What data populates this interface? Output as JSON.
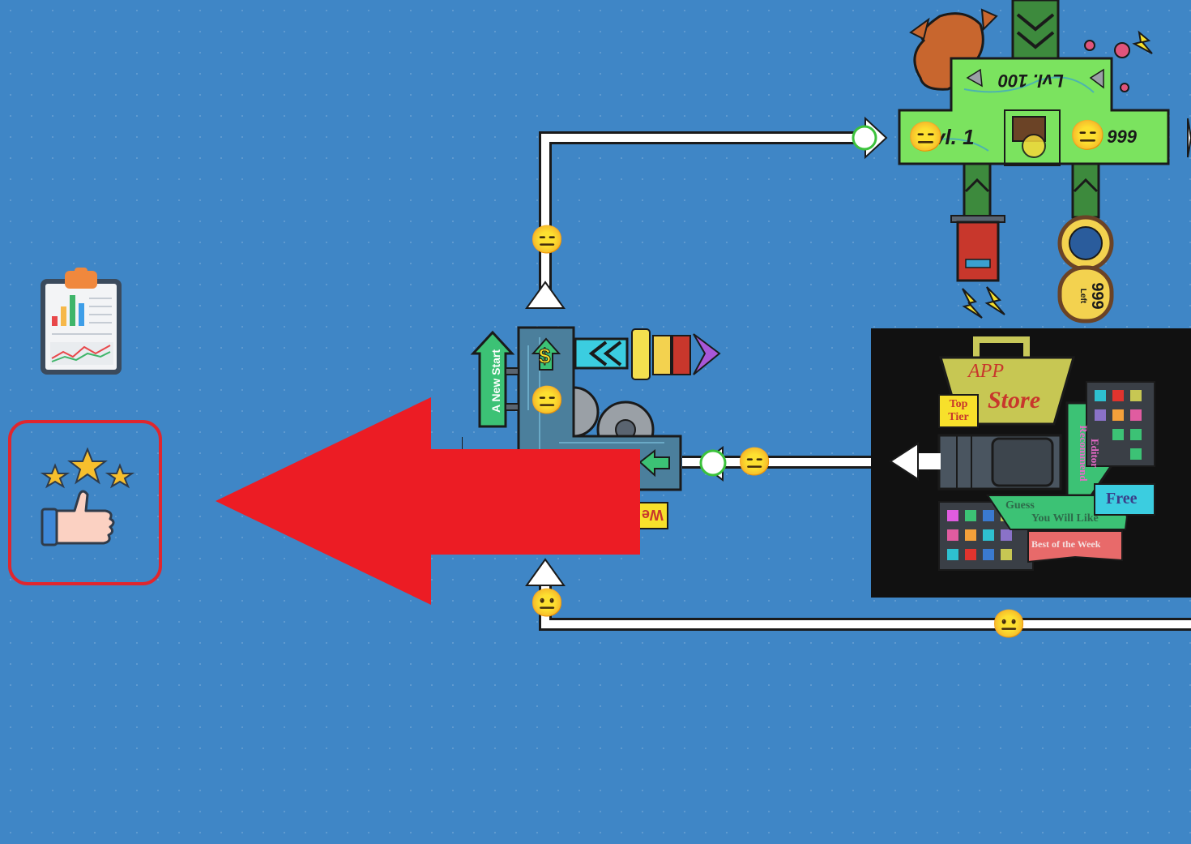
{
  "sidebar": {
    "report_tool": {
      "icon": "clipboard-chart-icon"
    },
    "rating_tool": {
      "icon": "stars-thumbs-up-icon",
      "highlight_color": "#e0262e"
    }
  },
  "hint_arrow": {
    "color": "#ec1c24",
    "direction": "left"
  },
  "pipes": {
    "color": "#ffffff"
  },
  "emojis": {
    "expressionless": "😑",
    "neutral": "😐"
  },
  "level_block": {
    "top_label": "Lvl. 100",
    "left_label": "vl. 1",
    "right_label": ". 999",
    "counter_value": "999",
    "counter_unit": "Left",
    "color": "#7be35f"
  },
  "start_block": {
    "sign_label": "A New Start",
    "currency_symbol": "$",
    "partial_label": "We"
  },
  "app_store_block": {
    "title_line1": "APP",
    "title_line2": "Store",
    "top_tier": [
      "Top",
      "Tier"
    ],
    "editor": [
      "Editor",
      "Recommend"
    ],
    "free_label": "Free",
    "guess": [
      "Guess",
      "You Will Like"
    ],
    "best_label": "Best of the Week"
  }
}
